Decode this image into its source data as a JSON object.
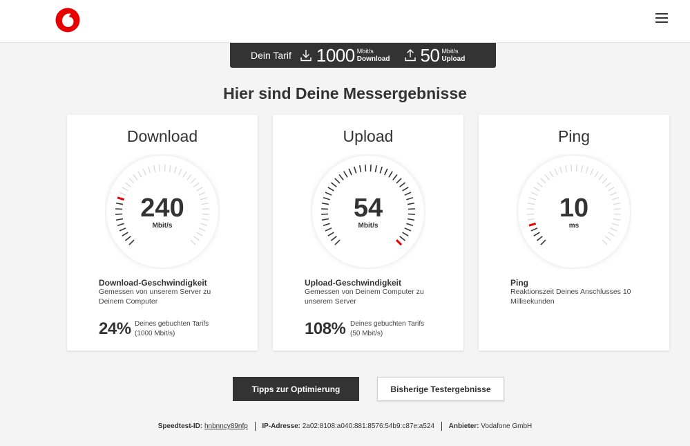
{
  "header": {
    "logo_name": "vodafone-logo",
    "menu_icon": "hamburger-menu-icon"
  },
  "tariff": {
    "label": "Dein Tarif",
    "download_value": "1000",
    "download_unit": "Mbit/s",
    "download_kind": "Download",
    "upload_value": "50",
    "upload_unit": "Mbit/s",
    "upload_kind": "Upload"
  },
  "page_title": "Hier sind Deine Messergebnisse",
  "cards": [
    {
      "title": "Download",
      "value": "240",
      "unit": "Mbit/s",
      "gauge_fraction": 0.24,
      "heading": "Download-Geschwindigkeit",
      "description": "Gemessen von unserem Server zu Deinem Computer",
      "percent": "24%",
      "percent_text_line1": "Deines gebuchten Tarifs",
      "percent_text_line2": "(1000 Mbit/s)"
    },
    {
      "title": "Upload",
      "value": "54",
      "unit": "Mbit/s",
      "gauge_fraction": 1.0,
      "heading": "Upload-Geschwindigkeit",
      "description": "Gemessen von Deinem Computer zu unserem Server",
      "percent": "108%",
      "percent_text_line1": "Deines gebuchten Tarifs",
      "percent_text_line2": "(50 Mbit/s)"
    },
    {
      "title": "Ping",
      "value": "10",
      "unit": "ms",
      "gauge_fraction": 0.1,
      "heading": "Ping",
      "description": "Reaktionszeit Deines Anschlusses 10 Millisekunden"
    }
  ],
  "buttons": {
    "primary": "Tipps zur Optimierung",
    "secondary": "Bisherige Testergebnisse"
  },
  "footer": {
    "speedtest_label": "Speedtest-ID:",
    "speedtest_id": "hnbnncy89nfp",
    "ip_label": "IP-Adresse:",
    "ip_value": "2a02:8108:a040:881:8576:54b9:c87e:a524",
    "provider_label": "Anbieter:",
    "provider_value": "Vodafone GmbH"
  },
  "colors": {
    "accent": "#e60000",
    "dark": "#333333",
    "tick_inactive": "#d6d6d6",
    "tick_active": "#333333"
  }
}
